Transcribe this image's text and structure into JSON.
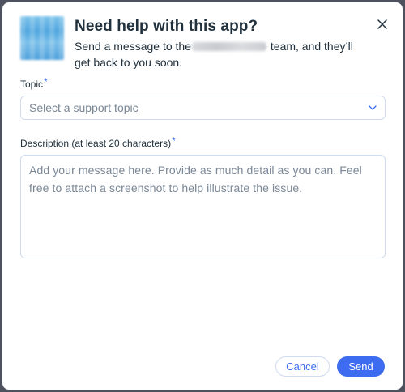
{
  "dialog": {
    "title": "Need help with this app?",
    "subtitle_before": "Send a message to the",
    "subtitle_after": " team, and they’ll get back to you soon.",
    "close_icon": "close-icon"
  },
  "form": {
    "topic_label": "Topic",
    "required_marker": "*",
    "topic_placeholder": "Select a support topic",
    "description_label": "Description (at least 20 characters)",
    "description_placeholder": "Add your message here. Provide as much detail as you can. Feel free to attach a screenshot to help illustrate the issue."
  },
  "actions": {
    "cancel_label": "Cancel",
    "send_label": "Send"
  },
  "colors": {
    "accent": "#3d6cf0",
    "text": "#20303c",
    "placeholder": "#7a8796",
    "border": "#cfdbef"
  }
}
